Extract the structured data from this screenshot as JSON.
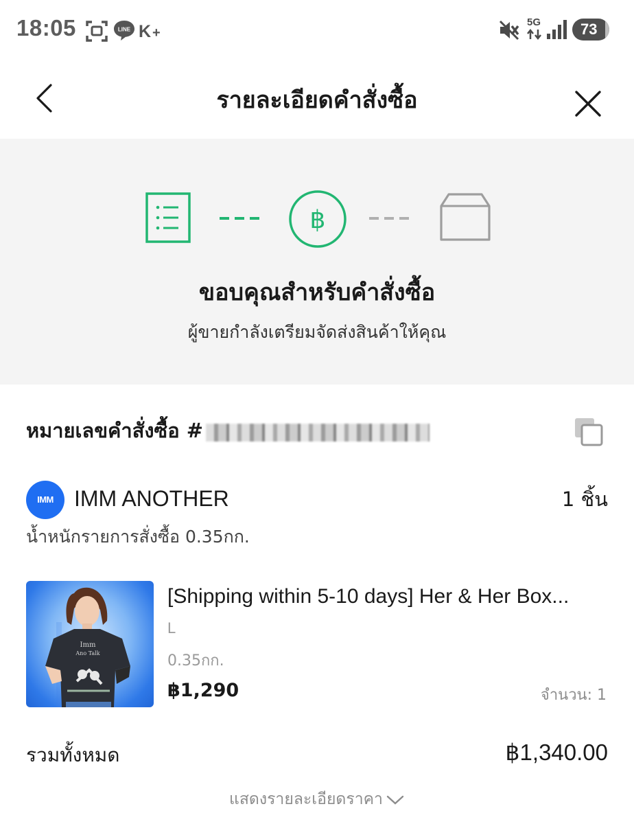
{
  "status_bar": {
    "time": "18:05",
    "network": "5G",
    "battery": "73",
    "icons": [
      "screenshot-icon",
      "line-app-icon",
      "k-plus-icon",
      "mute-icon",
      "signal-icon",
      "battery-icon"
    ]
  },
  "header": {
    "title": "รายละเอียดคำสั่งซื้อ"
  },
  "progress": {
    "steps": [
      {
        "name": "order-list-icon",
        "state": "done",
        "color": "#22b672"
      },
      {
        "name": "baht-payment-icon",
        "state": "done",
        "color": "#22b672"
      },
      {
        "name": "box-shipping-icon",
        "state": "pending",
        "color": "#9e9e9e"
      }
    ],
    "title": "ขอบคุณสำหรับคำสั่งซื้อ",
    "subtitle": "ผู้ขายกำลังเตรียมจัดส่งสินค้าให้คุณ"
  },
  "order": {
    "label": "หมายเลขคำสั่งซื้อ #"
  },
  "shop": {
    "logo_text": "IMM",
    "name": "IMM ANOTHER",
    "count": "1 ชิ้น",
    "weight": "น้ำหนักรายการสั่งซื้อ 0.35กก."
  },
  "product": {
    "title": "[Shipping within 5-10 days] Her & Her Box...",
    "variant": "L",
    "weight": "0.35กก.",
    "price": "฿1,290",
    "quantity": "จำนวน: 1"
  },
  "summary": {
    "total_label": "รวมทั้งหมด",
    "total_value": "฿1,340.00",
    "show_detail": "แสดงรายละเอียดราคา"
  },
  "colors": {
    "accent_green": "#22b672",
    "shop_logo_blue": "#1f6ef2",
    "section_grey": "#f4f4f4"
  }
}
